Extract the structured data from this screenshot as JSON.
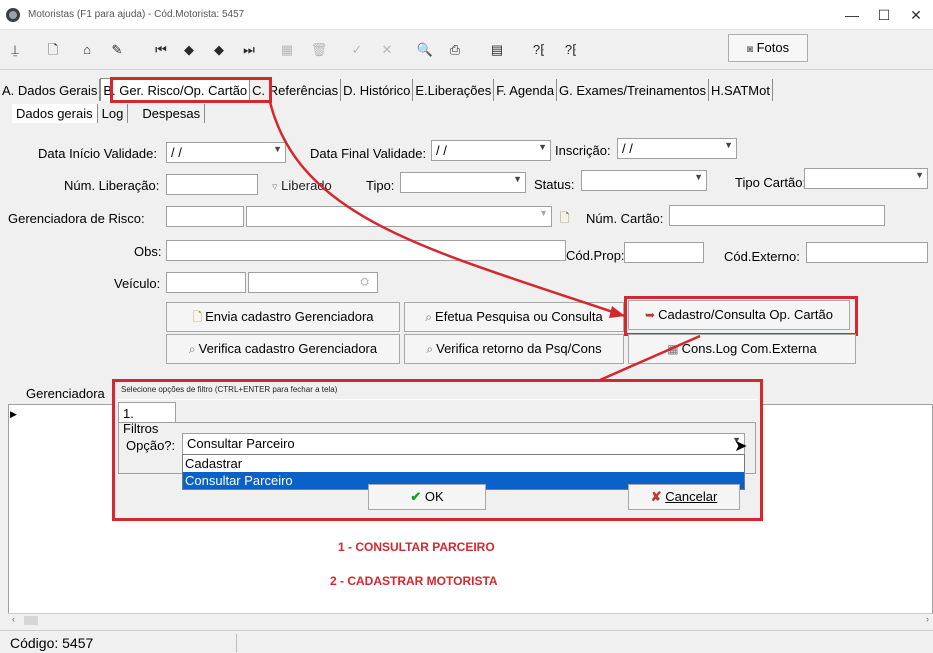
{
  "window": {
    "title": "Motoristas (F1 para ajuda) - Cód.Motorista: 5457",
    "minimize": "—",
    "maximize": "☐",
    "close": "✕"
  },
  "toolbar": {
    "fotos_label": "Fotos"
  },
  "tabs": [
    {
      "label": "A. Dados Gerais"
    },
    {
      "label": "B. Ger. Risco/Op. Cartão"
    },
    {
      "label": "C. Referências"
    },
    {
      "label": "D. Histórico"
    },
    {
      "label": "E.Liberações"
    },
    {
      "label": "F. Agenda"
    },
    {
      "label": "G. Exames/Treinamentos"
    },
    {
      "label": "H.SATMot"
    }
  ],
  "subtabs": [
    {
      "label": "Dados gerais"
    },
    {
      "label": "Log"
    },
    {
      "label": "Despesas"
    }
  ],
  "form": {
    "data_inicio_label": "Data Início Validade:",
    "data_inicio_value": "/ /",
    "data_final_label": "Data Final Validade:",
    "data_final_value": "/ /",
    "inscricao_label": "Inscrição:",
    "inscricao_value": "/ /",
    "num_liberacao_label": "Núm. Liberação:",
    "liberado_label": "Liberado",
    "tipo_label": "Tipo:",
    "status_label": "Status:",
    "tipo_cartao_label": "Tipo Cartão:",
    "gerenciadora_label": "Gerenciadora de Risco:",
    "num_cartao_label": "Núm. Cartão:",
    "obs_label": "Obs:",
    "cod_prop_label": "Cód.Prop:",
    "cod_externo_label": "Cód.Externo:",
    "veiculo_label": "Veículo:"
  },
  "buttons": {
    "envia_cadastro": "Envia cadastro Gerenciadora",
    "efetua_pesquisa": "Efetua Pesquisa ou Consulta",
    "cadastro_consulta": "Cadastro/Consulta Op. Cartão",
    "verifica_cadastro": "Verifica cadastro Gerenciadora",
    "verifica_retorno": "Verifica retorno da Psq/Cons",
    "cons_log": "Cons.Log Com.Externa"
  },
  "grid": {
    "column_header": "Gerenciadora"
  },
  "dialog": {
    "title": "Selecione opções de filtro (CTRL+ENTER para fechar a tela)",
    "tab_label": "1. Filtros",
    "opcao_label": "Opção?:",
    "opcao_value": "Consultar Parceiro",
    "options": [
      {
        "label": "Cadastrar",
        "selected": false
      },
      {
        "label": "Consultar Parceiro",
        "selected": true
      }
    ],
    "ok_label": "OK",
    "cancel_label": "Cancelar"
  },
  "annotations": {
    "step1": "1 - CONSULTAR PARCEIRO",
    "step2": "2 -  CADASTRAR MOTORISTA"
  },
  "status": {
    "codigo": "Código: 5457"
  },
  "colors": {
    "annotation_red": "#d4282e",
    "selection_blue": "#0a62c8"
  }
}
